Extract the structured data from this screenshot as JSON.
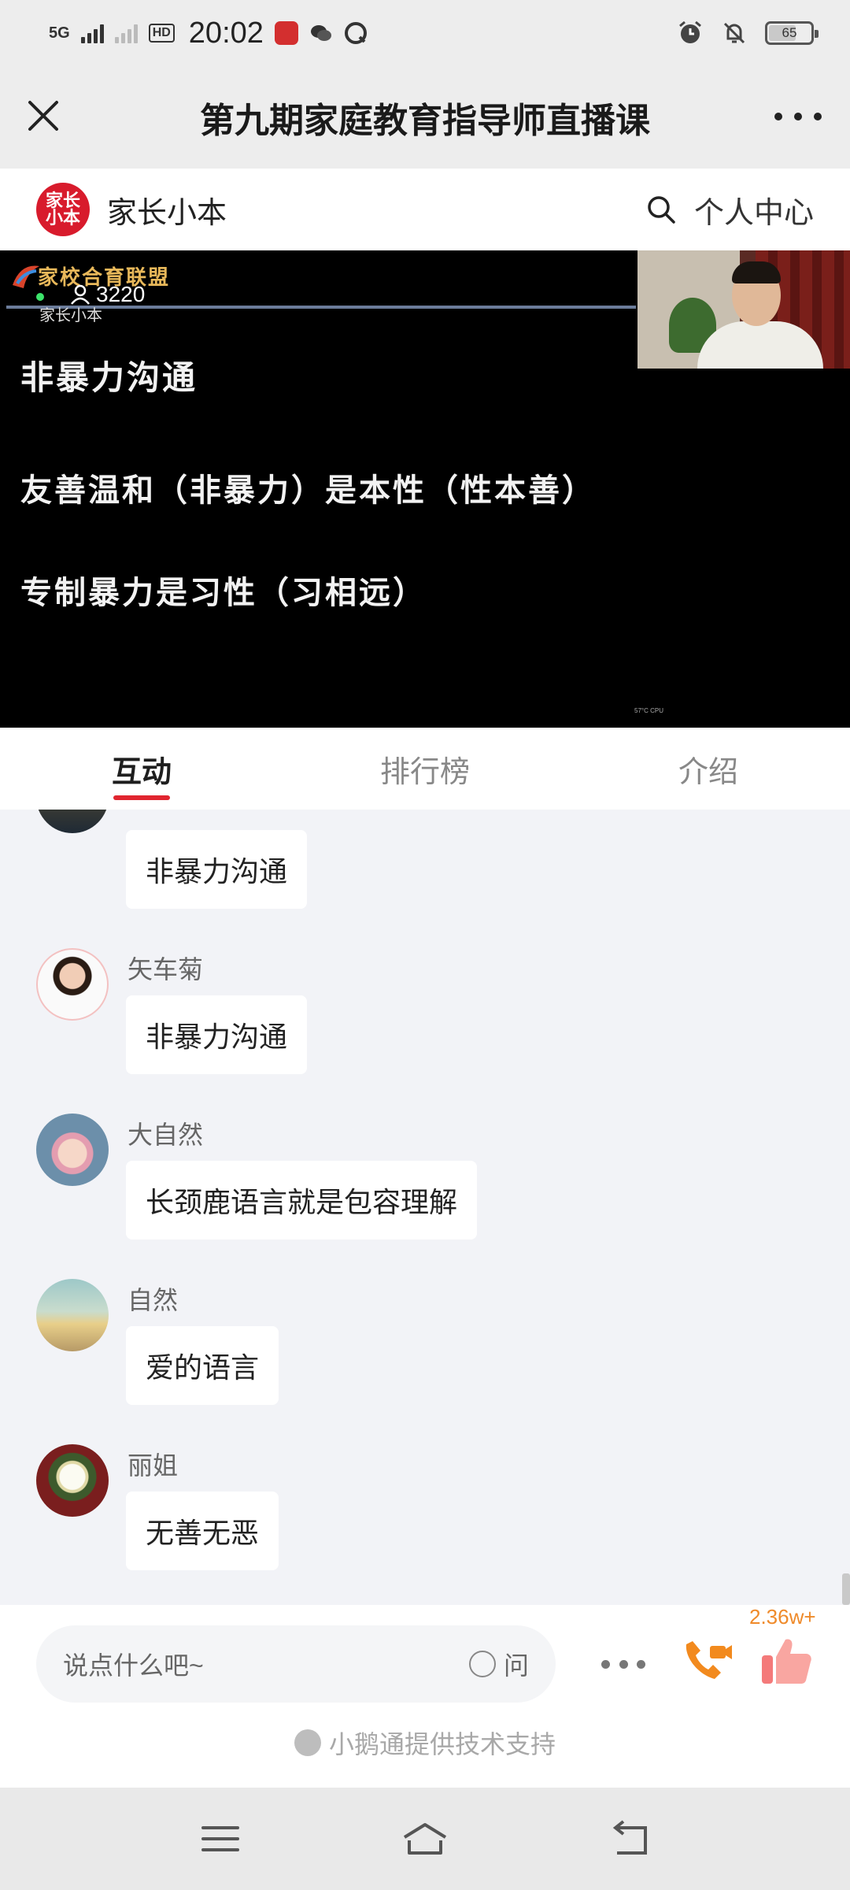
{
  "status": {
    "network": "5G",
    "hd": "HD",
    "time": "20:02",
    "battery": "65",
    "battery_level": 0.65
  },
  "titlebar": {
    "title": "第九期家庭教育指导师直播课"
  },
  "brand": {
    "logo_text": "家长小本",
    "name": "家长小本",
    "user_center": "个人中心"
  },
  "video": {
    "watermark_brand": "家校合育联盟",
    "watermark_sub": "家长小本",
    "viewers": "3220",
    "slide_lines": [
      "非暴力沟通",
      "友善温和（非暴力）是本性（性本善）",
      "专制暴力是习性（习相远）"
    ],
    "cpu_tag": "57°C CPU"
  },
  "tabs": [
    {
      "label": "互动",
      "active": true
    },
    {
      "label": "排行榜",
      "active": false
    },
    {
      "label": "介绍",
      "active": false
    }
  ],
  "messages": [
    {
      "name": "",
      "text": "非暴力沟通"
    },
    {
      "name": "矢车菊",
      "text": "非暴力沟通"
    },
    {
      "name": "大自然",
      "text": "长颈鹿语言就是包容理解"
    },
    {
      "name": "自然",
      "text": "爱的语言"
    },
    {
      "name": "丽姐",
      "text": "无善无恶"
    }
  ],
  "input": {
    "placeholder": "说点什么吧~",
    "ask_label": "问",
    "like_count": "2.36w+"
  },
  "footer": {
    "powered_by": "小鹅通提供技术支持"
  },
  "colors": {
    "accent": "#e0252f",
    "brand_red": "#d81b2c",
    "call_orange": "#f28a1e",
    "like_pink": "#f47a7a"
  }
}
